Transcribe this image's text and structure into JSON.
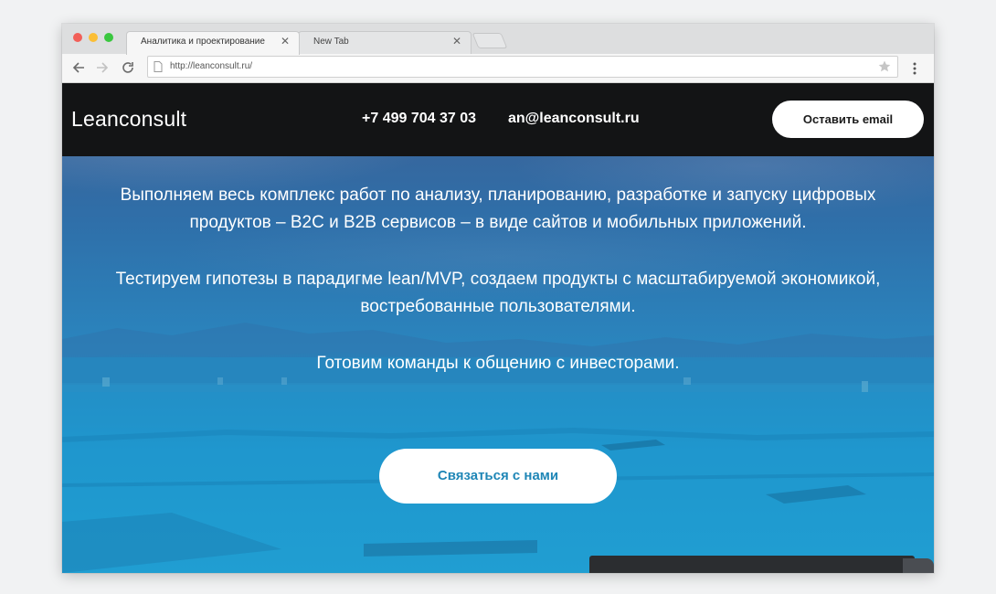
{
  "browser": {
    "tabs": [
      {
        "title": "Аналитика и проектирование",
        "close": "✕"
      },
      {
        "title": "New Tab",
        "close": "✕"
      }
    ],
    "url": "http://leanconsult.ru/"
  },
  "site": {
    "logo": "Leanconsult",
    "phone": "+7 499 704 37 03",
    "email": "an@leanconsult.ru",
    "email_button": "Оставить email"
  },
  "hero": {
    "line1": "Выполняем весь комплекс работ по анализу, планированию, разработке и запуску цифровых",
    "line2": "продуктов – B2C и B2B сервисов – в виде сайтов и мобильных приложений.",
    "line3": "Тестируем гипотезы в парадигме lean/MVP, создаем продукты с масштабируемой экономикой,",
    "line4": "востребованные пользователями.",
    "line5": "Готовим команды к общению с инвесторами.",
    "cta": "Связаться с нами"
  },
  "colors": {
    "header_bg": "#131415",
    "cta_text": "#1f86b6",
    "hero_top": "#3d5f93",
    "hero_bottom": "#21a3d6"
  },
  "icons": [
    "back-arrow-icon",
    "forward-arrow-icon",
    "reload-icon",
    "page-icon",
    "star-icon",
    "menu-dots-icon"
  ]
}
